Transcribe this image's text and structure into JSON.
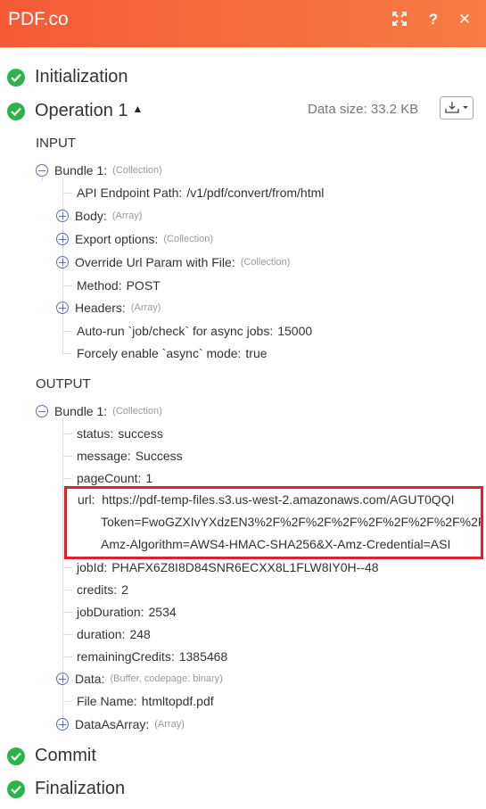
{
  "header": {
    "title": "PDF.co"
  },
  "stages": {
    "initialization": "Initialization",
    "operation": "Operation 1",
    "commit": "Commit",
    "finalization": "Finalization"
  },
  "data_size": "Data size: 33.2 KB",
  "input": {
    "label": "INPUT",
    "bundle": "Bundle 1:",
    "bundle_type": "(Collection)",
    "api_key": "API Endpoint Path:",
    "api_val": "/v1/pdf/convert/from/html",
    "body_key": "Body:",
    "body_type": "(Array)",
    "export_key": "Export options:",
    "export_type": "(Collection)",
    "override_key": "Override Url Param with File:",
    "override_type": "(Collection)",
    "method_key": "Method:",
    "method_val": "POST",
    "headers_key": "Headers:",
    "headers_type": "(Array)",
    "autorun_key": "Auto-run `job/check` for async jobs:",
    "autorun_val": "15000",
    "async_key": "Forcely enable `async` mode:",
    "async_val": "true"
  },
  "output": {
    "label": "OUTPUT",
    "bundle": "Bundle 1:",
    "bundle_type": "(Collection)",
    "status_key": "status:",
    "status_val": "success",
    "message_key": "message:",
    "message_val": "Success",
    "pagecount_key": "pageCount:",
    "pagecount_val": "1",
    "url_key": "url:",
    "url_line1": "https://pdf-temp-files.s3.us-west-2.amazonaws.com/AGUT0QQI",
    "url_line2": "Token=FwoGZXIvYXdzEN3%2F%2F%2F%2F%2F%2F%2F%2F%2F",
    "url_line3": "Amz-Algorithm=AWS4-HMAC-SHA256&X-Amz-Credential=ASI",
    "jobid_key": "jobId:",
    "jobid_val": "PHAFX6Z8I8D84SNR6ECXX8L1FLW8IY0H--48",
    "credits_key": "credits:",
    "credits_val": "2",
    "jobduration_key": "jobDuration:",
    "jobduration_val": "2534",
    "duration_key": "duration:",
    "duration_val": "248",
    "remaining_key": "remainingCredits:",
    "remaining_val": "1385468",
    "data_key": "Data:",
    "data_type": "(Buffer, codepage: binary)",
    "filename_key": "File Name:",
    "filename_val": "htmltopdf.pdf",
    "dataasarray_key": "DataAsArray:",
    "dataasarray_type": "(Array)"
  }
}
